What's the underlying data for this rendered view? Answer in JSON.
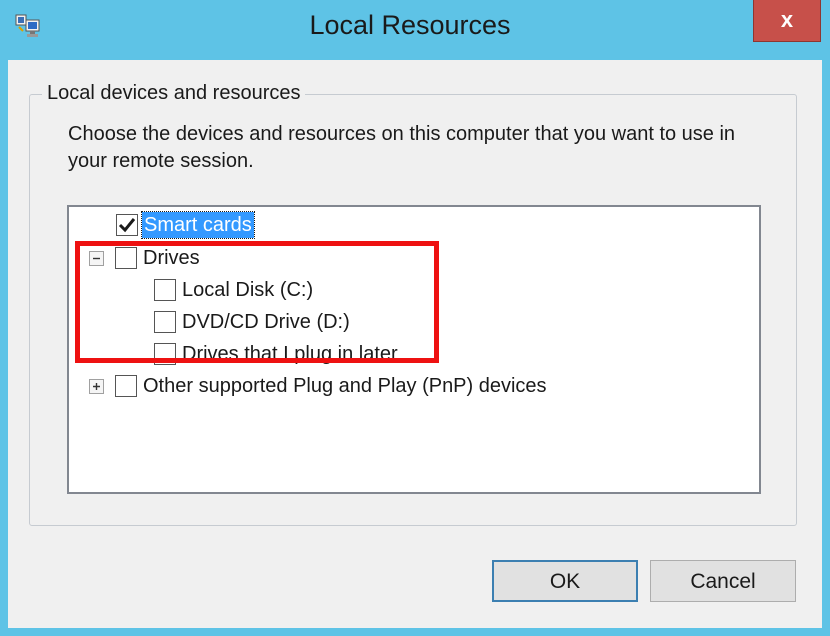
{
  "window": {
    "title": "Local Resources",
    "close_label": "x"
  },
  "group": {
    "legend": "Local devices and resources",
    "instruction": "Choose the devices and resources on this computer that you want to use in your remote session."
  },
  "tree": {
    "smart_cards": {
      "label": "Smart cards",
      "checked": true,
      "selected": true
    },
    "drives": {
      "label": "Drives",
      "checked": false,
      "expanded": true,
      "children": [
        {
          "label": "Local Disk (C:)",
          "checked": false
        },
        {
          "label": "DVD/CD Drive (D:)",
          "checked": false
        },
        {
          "label": "Drives that I plug in later",
          "checked": false
        }
      ]
    },
    "pnp": {
      "label": "Other supported Plug and Play (PnP) devices",
      "checked": false,
      "expanded": false
    }
  },
  "buttons": {
    "ok_label": "OK",
    "cancel_label": "Cancel"
  },
  "colors": {
    "title_bar": "#5ec3e6",
    "close_button": "#c7504a",
    "selection": "#3399ff",
    "annotation": "#ee1111"
  },
  "icons": {
    "app": "remote-desktop-icon",
    "check": "checkmark-icon",
    "collapse": "minus-expander-icon",
    "expand": "plus-expander-icon"
  }
}
